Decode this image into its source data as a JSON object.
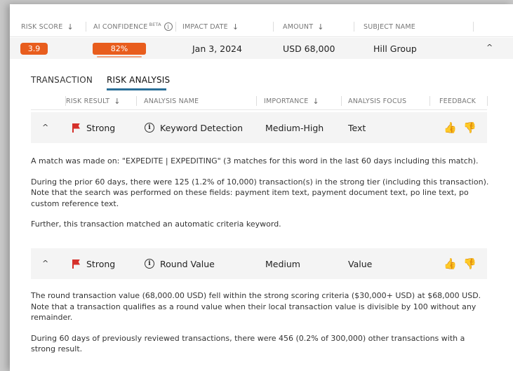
{
  "table_header": {
    "risk_score": "RISK SCORE",
    "ai_confidence": "AI CONFIDENCE",
    "beta": "BETA",
    "impact_date": "IMPACT DATE",
    "amount": "AMOUNT",
    "subject_name": "SUBJECT NAME",
    "sort_arrow": "↓",
    "info_glyph": "i"
  },
  "transaction_row": {
    "risk_score": "3.9",
    "ai_confidence": "82%",
    "ai_confidence_value": 0.82,
    "impact_date": "Jan 3, 2024",
    "amount": "USD 68,000",
    "subject_name": "Hill Group",
    "collapse_glyph": "^"
  },
  "tabs": [
    {
      "label": "TRANSACTION",
      "active": false
    },
    {
      "label": "RISK ANALYSIS",
      "active": true
    }
  ],
  "analysis_header": {
    "risk_result": "RISK RESULT",
    "analysis_name": "ANALYSIS NAME",
    "importance": "IMPORTANCE",
    "analysis_focus": "ANALYSIS FOCUS",
    "feedback": "FEEDBACK"
  },
  "analyses": [
    {
      "result": "Strong",
      "name": "Keyword Detection",
      "importance": "Medium-High",
      "focus": "Text",
      "paragraphs": [
        "A match was made on: \"EXPEDITE | EXPEDITING\" (3 matches for this word in the last 60 days including this match).",
        "During the prior 60 days, there were 125 (1.2% of 10,000) transaction(s) in the strong tier (including this transaction). Note that the search was performed on these fields: payment item text, payment document text, po line text, po custom reference text.",
        "Further, this transaction matched an automatic criteria keyword."
      ]
    },
    {
      "result": "Strong",
      "name": "Round Value",
      "importance": "Medium",
      "focus": "Value",
      "paragraphs": [
        "The round transaction value (68,000.00 USD) fell within the strong scoring criteria ($30,000+ USD) at $68,000 USD. Note that a transaction qualifies as a round value when their local transaction value is divisible by 100 without any remainder.",
        "During 60 days of previously reviewed transactions, there were 456 (0.2% of 300,000) other transactions with a strong result."
      ]
    }
  ],
  "icons": {
    "flag": "flag-icon",
    "thumbs_up": "thumbs-up-icon",
    "thumbs_down": "thumbs-down-icon",
    "thumbs_up_glyph": "👍",
    "thumbs_down_glyph": "👎"
  },
  "colors": {
    "accent_orange": "#e85d1d",
    "flag_red": "#d5302a",
    "tab_underline": "#2a6f97"
  }
}
